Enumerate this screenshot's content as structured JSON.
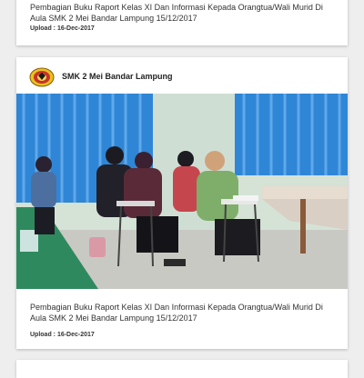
{
  "posts": [
    {
      "caption": "Pembagian Buku Raport Kelas XI Dan Informasi Kepada Orangtua/Wali Murid Di Aula SMK 2 Mei Bandar Lampung 15/12/2017",
      "upload": "Upload : 16-Dec-2017"
    },
    {
      "author": "SMK 2 Mei Bandar Lampung",
      "caption": "Pembagian Buku Raport Kelas XI Dan Informasi Kepada Orangtua/Wali Murid Di Aula SMK 2 Mei Bandar Lampung 15/12/2017",
      "upload": "Upload : 16-Dec-2017"
    }
  ],
  "colors": {
    "card": "#ffffff",
    "background": "#eeeeee",
    "text": "#333333",
    "curtain": "#2f86d6",
    "wall": "#d5e2d6",
    "table": "#2e8a5e"
  },
  "icons": {
    "school_logo": "school-logo"
  }
}
